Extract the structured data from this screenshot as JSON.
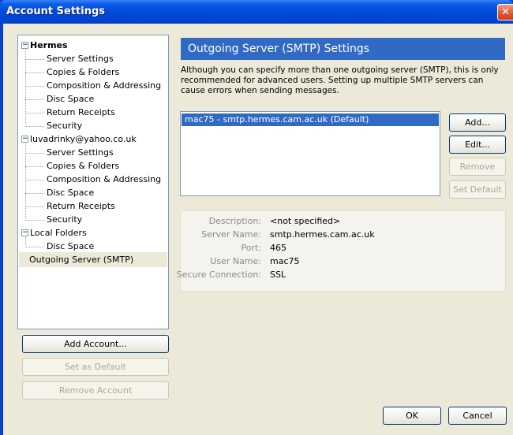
{
  "window": {
    "title": "Account Settings",
    "close_glyph": "✕"
  },
  "tree": {
    "accounts": [
      {
        "name": "Hermes",
        "bold": true,
        "expander": "−",
        "children": [
          "Server Settings",
          "Copies & Folders",
          "Composition & Addressing",
          "Disc Space",
          "Return Receipts",
          "Security"
        ]
      },
      {
        "name": "luvadrinky@yahoo.co.uk",
        "bold": false,
        "expander": "−",
        "children": [
          "Server Settings",
          "Copies & Folders",
          "Composition & Addressing",
          "Disc Space",
          "Return Receipts",
          "Security"
        ]
      },
      {
        "name": "Local Folders",
        "bold": false,
        "expander": "−",
        "children": [
          "Disc Space"
        ]
      }
    ],
    "outgoing_item": "Outgoing Server (SMTP)"
  },
  "left_buttons": {
    "add_account": "Add Account...",
    "set_default": "Set as Default",
    "remove_account": "Remove Account"
  },
  "panel": {
    "title": "Outgoing Server (SMTP) Settings",
    "description": "Although you can specify more than one outgoing server (SMTP), this is only recommended for advanced users. Setting up multiple SMTP servers can cause errors when sending messages.",
    "servers": [
      "mac75 - smtp.hermes.cam.ac.uk (Default)"
    ],
    "buttons": {
      "add": "Add...",
      "edit": "Edit...",
      "remove": "Remove",
      "set_default": "Set Default"
    },
    "details": {
      "description_label": "Description:",
      "description_value": "<not specified>",
      "server_name_label": "Server Name:",
      "server_name_value": "smtp.hermes.cam.ac.uk",
      "port_label": "Port:",
      "port_value": "465",
      "user_name_label": "User Name:",
      "user_name_value": "mac75",
      "secure_label": "Secure Connection:",
      "secure_value": "SSL"
    }
  },
  "footer": {
    "ok": "OK",
    "cancel": "Cancel"
  },
  "colors": {
    "selection": "#316ac5",
    "dialog_bg": "#ece9d8",
    "title_bar": "#0048d8"
  }
}
